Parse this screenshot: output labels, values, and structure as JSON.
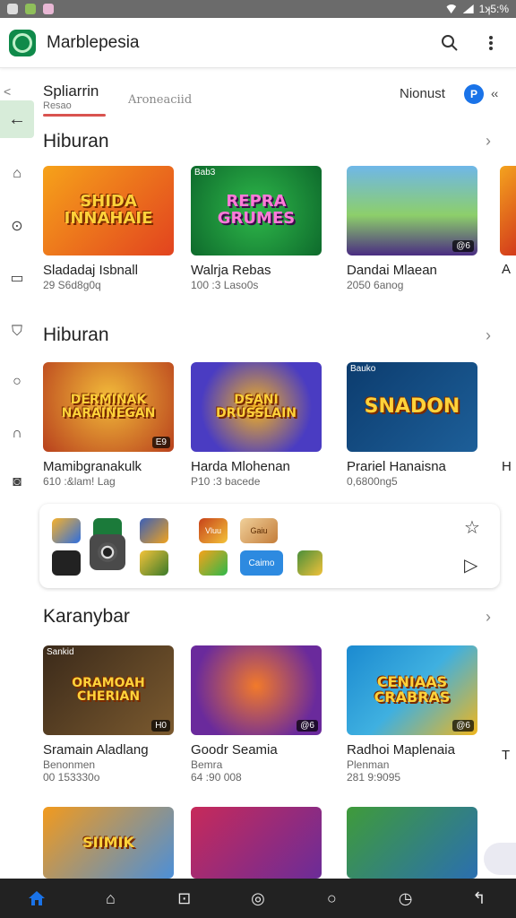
{
  "app": {
    "title": "Marblepesia"
  },
  "status_bar": {
    "right_text": "1ʞ5:%"
  },
  "tabs": {
    "back": "<",
    "primary_label": "Spliarrin",
    "primary_sub": "Resao",
    "secondary_label": "Aroneaciid",
    "right_label": "Nionust",
    "avatar_letter": "P",
    "more": "‹‹"
  },
  "sections": [
    {
      "title": "Hiburan",
      "cards": [
        {
          "title": "Sladadaj Isbnall",
          "sub": "29 S6d8g0q",
          "art_text": "SHIDA INNAHAIE",
          "colors": [
            "#f6a21a",
            "#e2431f"
          ]
        },
        {
          "title": "Walrja Rebas",
          "sub": "100 :3 Laso0s",
          "art_text": "REPRA GRUMES",
          "colors": [
            "#2eb84a",
            "#0e6a2c"
          ],
          "corner": "Bab3"
        },
        {
          "title": "Dandai Mlaean",
          "sub": "2050 6anog",
          "art_text": "",
          "colors": [
            "#6fb7e8",
            "#4a2c82"
          ],
          "badge": "@6"
        }
      ]
    },
    {
      "title": "Hiburan",
      "cards": [
        {
          "title": "Mamibgranakulk",
          "sub": "610 :&lam! Lag",
          "art_text": "DERMINAK NARAINEGAN",
          "colors": [
            "#f2bb3a",
            "#b8401d"
          ],
          "badge": "E9"
        },
        {
          "title": "Harda Mlohenan",
          "sub": "P10 :3 bacede",
          "art_text": "DSANI DRUSSLAIN",
          "colors": [
            "#4a3cc2",
            "#f3b21f"
          ]
        },
        {
          "title": "Prariel Hanaisna",
          "sub": "0,6800ng5",
          "art_text": "SNADON",
          "colors": [
            "#0c3c6e",
            "#1d5f99"
          ],
          "corner": "Bauko"
        }
      ]
    },
    {
      "title": "Karanybar",
      "cards": [
        {
          "title": "Sramain Aladlang",
          "sub": "Benonmen",
          "sub2": "00 153330o",
          "art_text": "ORAMOAH CHERIAN",
          "colors": [
            "#3b2a1a",
            "#7b5a2f"
          ],
          "badge": "H0",
          "corner": "Sankid"
        },
        {
          "title": "Goodr Seamia",
          "sub": "Bemra",
          "sub2": "64 :90 008",
          "art_text": "",
          "colors": [
            "#6a2a9c",
            "#f27a2a"
          ],
          "badge": "@6"
        },
        {
          "title": "Radhoi Maplenaia",
          "sub": "Plenman",
          "sub2": "281 9:9095",
          "art_text": "CENIAAS CRABRAS",
          "colors": [
            "#1b8ad0",
            "#f0b61d"
          ],
          "badge": "@6"
        }
      ]
    },
    {
      "title": "",
      "cards": [
        {
          "title": "",
          "sub": "",
          "art_text": "SIIMIK",
          "colors": [
            "#f29a1d",
            "#4c8fd8"
          ]
        },
        {
          "title": "",
          "sub": "",
          "art_text": "",
          "colors": [
            "#c72a5a",
            "#6b2c98"
          ]
        },
        {
          "title": "",
          "sub": "",
          "art_text": "",
          "colors": [
            "#3f9b3a",
            "#2b6fb0"
          ]
        }
      ]
    }
  ],
  "edge_labels": [
    "A",
    "H",
    "T"
  ],
  "widget": {
    "mini_labels": [
      "Vluu",
      "Gaiu",
      "Caimo"
    ]
  }
}
